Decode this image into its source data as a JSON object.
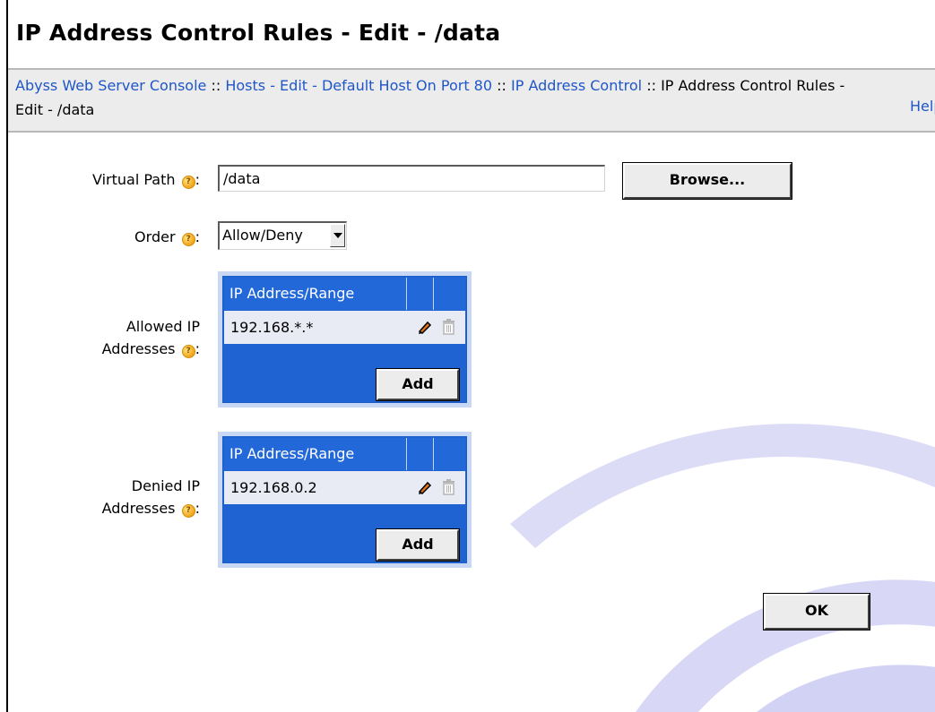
{
  "page": {
    "title": "IP Address Control Rules - Edit - /data"
  },
  "breadcrumb": {
    "items": [
      "Abyss Web Server Console",
      "Hosts - Edit - Default Host On Port 80",
      "IP Address Control"
    ],
    "separator": "::",
    "current": "IP Address Control Rules - Edit - /data",
    "help": "Help"
  },
  "form": {
    "virtual_path": {
      "label": "Virtual Path",
      "value": "/data",
      "browse_label": "Browse..."
    },
    "order": {
      "label": "Order",
      "selected": "Allow/Deny"
    },
    "allowed": {
      "label_line1": "Allowed IP",
      "label_line2": "Addresses",
      "header": "IP Address/Range",
      "entries": [
        "192.168.*.*"
      ],
      "add_label": "Add"
    },
    "denied": {
      "label_line1": "Denied IP",
      "label_line2": "Addresses",
      "header": "IP Address/Range",
      "entries": [
        "192.168.0.2"
      ],
      "add_label": "Add"
    },
    "ok_label": "OK"
  },
  "icons": {
    "help": "help-question-icon",
    "edit": "pencil-icon",
    "delete": "trash-icon"
  },
  "colors": {
    "link": "#1f56c8",
    "table_blue": "#1f63d2",
    "row_bg": "#e8eaf4",
    "watermark": "#dcdcf6"
  }
}
